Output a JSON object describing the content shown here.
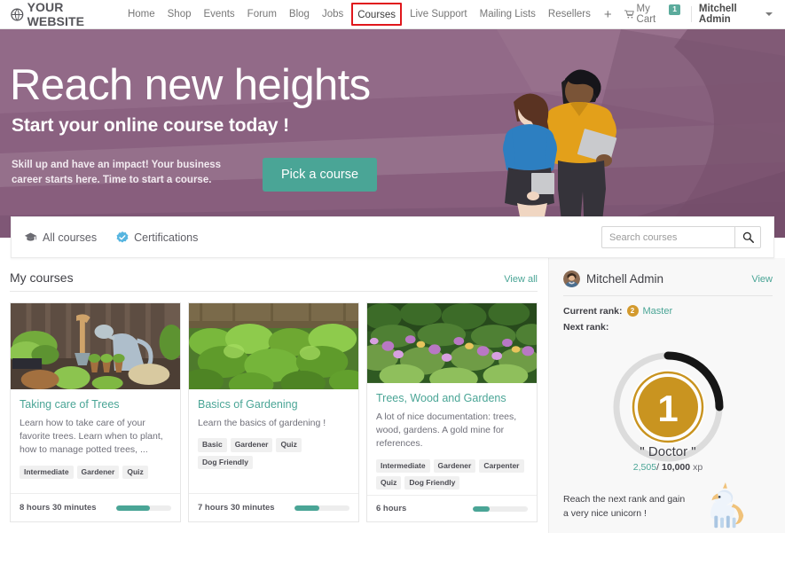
{
  "brand": {
    "name": "YOUR WEBSITE",
    "logo_icon": "globe-icon"
  },
  "nav": {
    "links": [
      {
        "label": "Home",
        "current": false
      },
      {
        "label": "Shop",
        "current": false
      },
      {
        "label": "Events",
        "current": false
      },
      {
        "label": "Forum",
        "current": false
      },
      {
        "label": "Blog",
        "current": false
      },
      {
        "label": "Jobs",
        "current": false
      },
      {
        "label": "Courses",
        "current": true
      },
      {
        "label": "Live Support",
        "current": false
      },
      {
        "label": "Mailing Lists",
        "current": false
      },
      {
        "label": "Resellers",
        "current": false
      }
    ],
    "plus_icon": "plus-icon",
    "cart": {
      "icon": "cart-icon",
      "label": "My Cart",
      "count": "1",
      "badge_color": "#5bab9c"
    },
    "user": {
      "name": "Mitchell Admin",
      "caret_icon": "chevron-down-icon"
    },
    "highlight_color": "#e0171c"
  },
  "hero": {
    "title": "Reach new heights",
    "subtitle": "Start your online course today !",
    "paragraph": "Skill up and have an impact! Your business career starts here. Time to start a course.",
    "cta_label": "Pick a course",
    "cta_color": "#4aa596",
    "bg_color": "#8b6281"
  },
  "strip": {
    "tabs": [
      {
        "label": "All courses",
        "icon": "graduation-cap-icon"
      },
      {
        "label": "Certifications",
        "icon": "certificate-check-icon"
      }
    ],
    "search": {
      "placeholder": "Search courses",
      "value": "",
      "button_icon": "search-icon"
    }
  },
  "main": {
    "section_title": "My courses",
    "view_all_label": "View all",
    "courses": [
      {
        "title": "Taking care of Trees",
        "description": "Learn how to take care of your favorite trees. Learn when to plant, how to manage potted trees, ...",
        "tags": [
          "Intermediate",
          "Gardener",
          "Quiz"
        ],
        "duration": "8 hours 30 minutes",
        "progress": 62,
        "image": "garden-tools-photo"
      },
      {
        "title": "Basics of Gardening",
        "description": "Learn the basics of gardening !",
        "tags": [
          "Basic",
          "Gardener",
          "Quiz",
          "Dog Friendly"
        ],
        "duration": "7 hours 30 minutes",
        "progress": 45,
        "image": "lettuce-garden-photo"
      },
      {
        "title": "Trees, Wood and Gardens",
        "description": "A lot of nice documentation: trees, wood, gardens. A gold mine for references.",
        "tags": [
          "Intermediate",
          "Gardener",
          "Carpenter",
          "Quiz",
          "Dog Friendly"
        ],
        "duration": "6 hours",
        "progress": 30,
        "image": "flower-garden-photo"
      }
    ]
  },
  "sidebar": {
    "profile": {
      "name": "Mitchell Admin",
      "view_label": "View",
      "avatar": "user-avatar"
    },
    "current_rank_label": "Current rank:",
    "current_rank_value": "Master",
    "current_rank_number": "2",
    "next_rank_label": "Next rank:",
    "next_rank": {
      "number": "1",
      "title": "\" Doctor \"",
      "xp_current": "2,505",
      "xp_separator": "/",
      "xp_total": "10,000",
      "xp_unit": "xp",
      "progress": 25,
      "medal_color": "#d39a2e"
    },
    "reward": {
      "text": "Reach the next rank and gain a very nice unicorn !",
      "icon": "unicorn-icon"
    }
  }
}
